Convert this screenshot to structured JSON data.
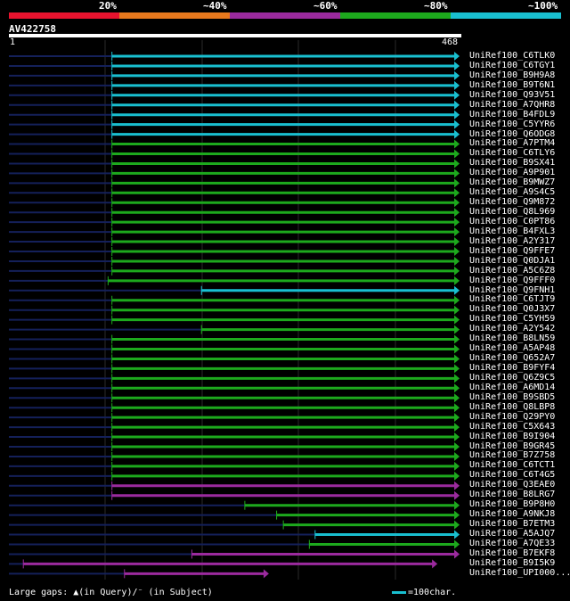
{
  "header": {
    "scale_labels": [
      "20%",
      "~40%",
      "~60%",
      "~80%",
      "~100%"
    ],
    "scale_colors": [
      "#e8132e",
      "#e8791d",
      "#9b2a9e",
      "#1da91d",
      "#19bfd0"
    ]
  },
  "query": {
    "id": "AV422758",
    "start": "1",
    "end": "468"
  },
  "legend": {
    "gaps_text": "Large gaps: ▲(in Query)/⁻ (in Subject)",
    "key_text": "=100char."
  },
  "chart_data": {
    "type": "alignment",
    "query_length": 468,
    "hits": [
      {
        "id": "UniRef100_C6TLK0",
        "color": "cyan",
        "start": 107,
        "end": 468
      },
      {
        "id": "UniRef100_C6TGY1",
        "color": "cyan",
        "start": 107,
        "end": 468
      },
      {
        "id": "UniRef100_B9H9A8",
        "color": "cyan",
        "start": 107,
        "end": 468
      },
      {
        "id": "UniRef100_B9T6N1",
        "color": "cyan",
        "start": 107,
        "end": 468
      },
      {
        "id": "UniRef100_Q93V51",
        "color": "cyan",
        "start": 107,
        "end": 468
      },
      {
        "id": "UniRef100_A7QHR8",
        "color": "cyan",
        "start": 107,
        "end": 468
      },
      {
        "id": "UniRef100_B4FDL9",
        "color": "cyan",
        "start": 107,
        "end": 468
      },
      {
        "id": "UniRef100_C5YYR6",
        "color": "cyan",
        "start": 107,
        "end": 468
      },
      {
        "id": "UniRef100_Q6ODG8",
        "color": "cyan",
        "start": 107,
        "end": 468
      },
      {
        "id": "UniRef100_A7PTM4",
        "color": "green",
        "start": 107,
        "end": 468
      },
      {
        "id": "UniRef100_C6TLY6",
        "color": "green",
        "start": 107,
        "end": 468
      },
      {
        "id": "UniRef100_B9SX41",
        "color": "green",
        "start": 107,
        "end": 468
      },
      {
        "id": "UniRef100_A9P901",
        "color": "green",
        "start": 107,
        "end": 468
      },
      {
        "id": "UniRef100_B9MWZ7",
        "color": "green",
        "start": 107,
        "end": 468
      },
      {
        "id": "UniRef100_A9S4C5",
        "color": "green",
        "start": 107,
        "end": 468
      },
      {
        "id": "UniRef100_Q9M872",
        "color": "green",
        "start": 107,
        "end": 468
      },
      {
        "id": "UniRef100_Q8L969",
        "color": "green",
        "start": 107,
        "end": 468
      },
      {
        "id": "UniRef100_C0PT86",
        "color": "green",
        "start": 107,
        "end": 468
      },
      {
        "id": "UniRef100_B4FXL3",
        "color": "green",
        "start": 107,
        "end": 468
      },
      {
        "id": "UniRef100_A2Y317",
        "color": "green",
        "start": 107,
        "end": 468
      },
      {
        "id": "UniRef100_Q9FFE7",
        "color": "green",
        "start": 107,
        "end": 468
      },
      {
        "id": "UniRef100_Q0DJA1",
        "color": "green",
        "start": 107,
        "end": 468
      },
      {
        "id": "UniRef100_A5C6Z8",
        "color": "green",
        "start": 107,
        "end": 468
      },
      {
        "id": "UniRef100_Q9FFF0",
        "color": "green",
        "start": 103,
        "end": 468
      },
      {
        "id": "UniRef100_Q9FNH1",
        "color": "cyan",
        "start": 200,
        "end": 468
      },
      {
        "id": "UniRef100_C6TJT9",
        "color": "green",
        "start": 107,
        "end": 468
      },
      {
        "id": "UniRef100_Q0J3X7",
        "color": "green",
        "start": 107,
        "end": 468
      },
      {
        "id": "UniRef100_C5YH59",
        "color": "green",
        "start": 107,
        "end": 468
      },
      {
        "id": "UniRef100_A2Y542",
        "color": "green",
        "start": 200,
        "end": 468
      },
      {
        "id": "UniRef100_B8LN59",
        "color": "green",
        "start": 107,
        "end": 468
      },
      {
        "id": "UniRef100_A5AP48",
        "color": "green",
        "start": 107,
        "end": 468
      },
      {
        "id": "UniRef100_Q652A7",
        "color": "green",
        "start": 107,
        "end": 468
      },
      {
        "id": "UniRef100_B9FYF4",
        "color": "green",
        "start": 107,
        "end": 468
      },
      {
        "id": "UniRef100_Q6Z9C5",
        "color": "green",
        "start": 107,
        "end": 468
      },
      {
        "id": "UniRef100_A6MD14",
        "color": "green",
        "start": 107,
        "end": 468
      },
      {
        "id": "UniRef100_B9SBD5",
        "color": "green",
        "start": 107,
        "end": 468
      },
      {
        "id": "UniRef100_Q8LBP8",
        "color": "green",
        "start": 107,
        "end": 468
      },
      {
        "id": "UniRef100_Q29PY0",
        "color": "green",
        "start": 107,
        "end": 468
      },
      {
        "id": "UniRef100_C5X643",
        "color": "green",
        "start": 107,
        "end": 468
      },
      {
        "id": "UniRef100_B9I904",
        "color": "green",
        "start": 107,
        "end": 468
      },
      {
        "id": "UniRef100_B9GR45",
        "color": "green",
        "start": 107,
        "end": 468
      },
      {
        "id": "UniRef100_B7Z758",
        "color": "green",
        "start": 107,
        "end": 468
      },
      {
        "id": "UniRef100_C6TCT1",
        "color": "green",
        "start": 107,
        "end": 468
      },
      {
        "id": "UniRef100_C6T4G5",
        "color": "green",
        "start": 107,
        "end": 468
      },
      {
        "id": "UniRef100_Q3EAE0",
        "color": "purple",
        "start": 107,
        "end": 468
      },
      {
        "id": "UniRef100_B8LRG7",
        "color": "purple",
        "start": 107,
        "end": 468
      },
      {
        "id": "UniRef100_B9P8H0",
        "color": "green",
        "start": 245,
        "end": 468
      },
      {
        "id": "UniRef100_A9NKJ8",
        "color": "green",
        "start": 278,
        "end": 468
      },
      {
        "id": "UniRef100_B7ETM3",
        "color": "green",
        "start": 285,
        "end": 468
      },
      {
        "id": "UniRef100_A5AJQ7",
        "color": "cyan",
        "start": 318,
        "end": 468
      },
      {
        "id": "UniRef100_A7QE33",
        "color": "green",
        "start": 312,
        "end": 468
      },
      {
        "id": "UniRef100_B7EKF8",
        "color": "purple",
        "start": 190,
        "end": 468
      },
      {
        "id": "UniRef100_B9I5K9",
        "color": "purple",
        "start": 15,
        "end": 445
      },
      {
        "id": "UniRef100_UPI000...",
        "color": "purple",
        "start": 120,
        "end": 270
      }
    ]
  }
}
